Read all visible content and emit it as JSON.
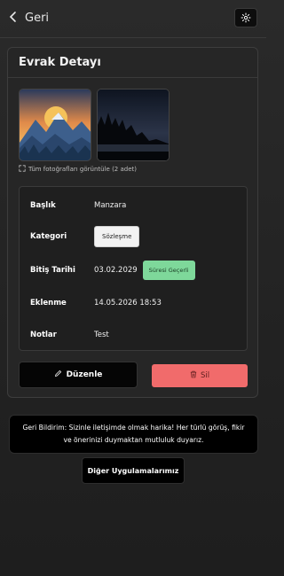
{
  "header": {
    "back_label": "Geri",
    "back_icon": "chevron-left-icon",
    "settings_icon": "gear-icon"
  },
  "card": {
    "title": "Evrak Detayı",
    "photos": [
      {
        "name": "mountain-sunset-photo"
      },
      {
        "name": "forest-night-photo"
      }
    ],
    "view_all_label": "Tüm fotoğrafları görüntüle (2 adet)"
  },
  "details": {
    "title_label": "Başlık",
    "title_value": "Manzara",
    "category_label": "Kategori",
    "category_value": "Sözleşme",
    "expiry_label": "Bitiş Tarihi",
    "expiry_value": "03.02.2029",
    "expiry_status": "Süresi Geçerli",
    "added_label": "Eklenme",
    "added_value": "14.05.2026 18:53",
    "notes_label": "Notlar",
    "notes_value": "Test"
  },
  "actions": {
    "edit_label": "Düzenle",
    "delete_label": "Sil"
  },
  "feedback": {
    "text": "Geri Bildirim: Sizinle iletişimde olmak harika! Her türlü görüş, fikir ve önerinizi duymaktan mutluluk duyarız."
  },
  "other_apps_label": "Diğer Uygulamalarımız",
  "colors": {
    "background": "#222222",
    "card": "#262626",
    "delete": "#f16b6b",
    "status_green": "#7ed89a"
  }
}
